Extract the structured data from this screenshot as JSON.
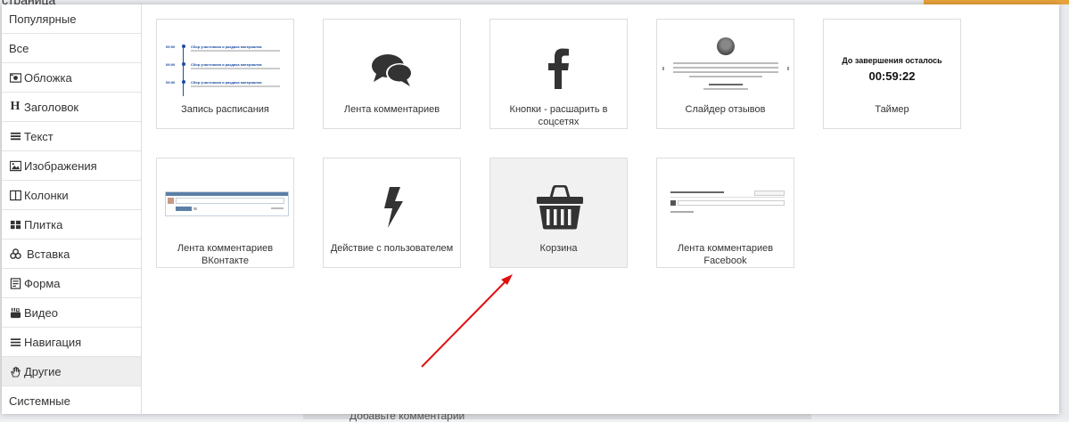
{
  "background": {
    "top_text": "страница",
    "bottom_text": "Добавьте комментарий"
  },
  "sidebar": {
    "items": [
      {
        "label": "Популярные",
        "icon": ""
      },
      {
        "label": "Все",
        "icon": ""
      },
      {
        "label": "Обложка",
        "icon": "camera-icon"
      },
      {
        "label": "Заголовок",
        "icon": "heading-icon"
      },
      {
        "label": "Текст",
        "icon": "text-lines-icon"
      },
      {
        "label": "Изображения",
        "icon": "image-icon"
      },
      {
        "label": "Колонки",
        "icon": "columns-icon"
      },
      {
        "label": "Плитка",
        "icon": "tiles-icon"
      },
      {
        "label": "Вставка",
        "icon": "cubes-icon"
      },
      {
        "label": "Форма",
        "icon": "form-icon"
      },
      {
        "label": "Видео",
        "icon": "youtube-icon"
      },
      {
        "label": "Навигация",
        "icon": "menu-icon"
      },
      {
        "label": "Другие",
        "icon": "hand-icon"
      },
      {
        "label": "Системные",
        "icon": ""
      }
    ],
    "active": "Другие"
  },
  "tiles": [
    {
      "label": "Запись расписания",
      "icon": "schedule-thumbnail"
    },
    {
      "label": "Лента комментариев",
      "icon": "comments-icon"
    },
    {
      "label": "Кнопки - расшарить в соцсетях",
      "icon": "facebook-icon"
    },
    {
      "label": "Слайдер отзывов",
      "icon": "reviews-slider-thumbnail"
    },
    {
      "label": "Таймер",
      "icon": "timer-thumbnail"
    },
    {
      "label": "Лента комментариев ВКонтакте",
      "icon": "vk-comments-thumbnail"
    },
    {
      "label": "Действие с пользователем",
      "icon": "lightning-icon"
    },
    {
      "label": "Корзина",
      "icon": "basket-icon"
    },
    {
      "label": "Лента комментариев Facebook",
      "icon": "fb-comments-thumbnail"
    }
  ],
  "schedule_thumb": {
    "rows": [
      {
        "time": "09:00",
        "title": "Сбор участников и раздача материалов"
      },
      {
        "time": "09:00",
        "title": "Сбор участников и раздача материалов"
      },
      {
        "time": "09:00",
        "title": "Сбор участников и раздача материалов"
      }
    ]
  },
  "timer_thumb": {
    "heading": "До завершения осталось",
    "value": "00:59:22"
  },
  "colors": {
    "accent_blue": "#1a4da1",
    "icon_dark": "#333333",
    "arrow": "#e01010",
    "vk_header": "#5b7fa6"
  }
}
